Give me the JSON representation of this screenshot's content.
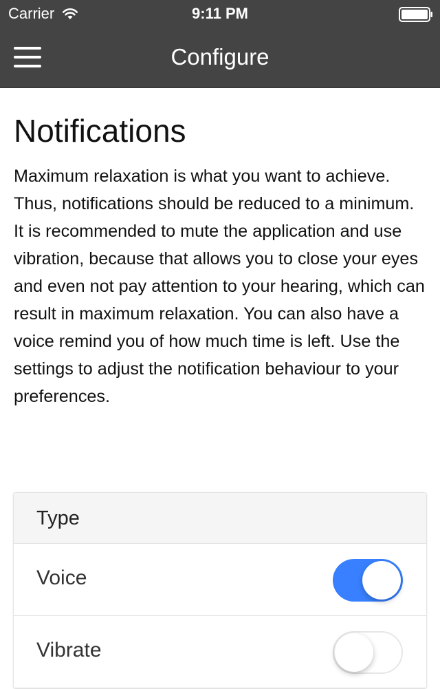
{
  "status_bar": {
    "carrier": "Carrier",
    "time": "9:11 PM",
    "icons": [
      "wifi-icon",
      "battery-icon"
    ]
  },
  "nav_bar": {
    "title": "Configure",
    "menu_icon": "hamburger-menu-icon"
  },
  "main": {
    "title": "Notifications",
    "description": "Maximum relaxation is what you want to achieve. Thus, notifications should be reduced to a minimum. It is recommended to mute the application and use vibration, because that allows you to close your eyes and even not pay attention to your hearing, which can result in maximum relaxation. You can also have a voice remind you of how much time is left. Use the settings to adjust the notification behaviour to your preferences."
  },
  "settings": {
    "header": "Type",
    "items": [
      {
        "label": "Voice",
        "enabled": true
      },
      {
        "label": "Vibrate",
        "enabled": false
      }
    ]
  },
  "colors": {
    "bar_background": "#444444",
    "toggle_on": "#3880ff",
    "card_header_background": "#f5f5f5"
  }
}
